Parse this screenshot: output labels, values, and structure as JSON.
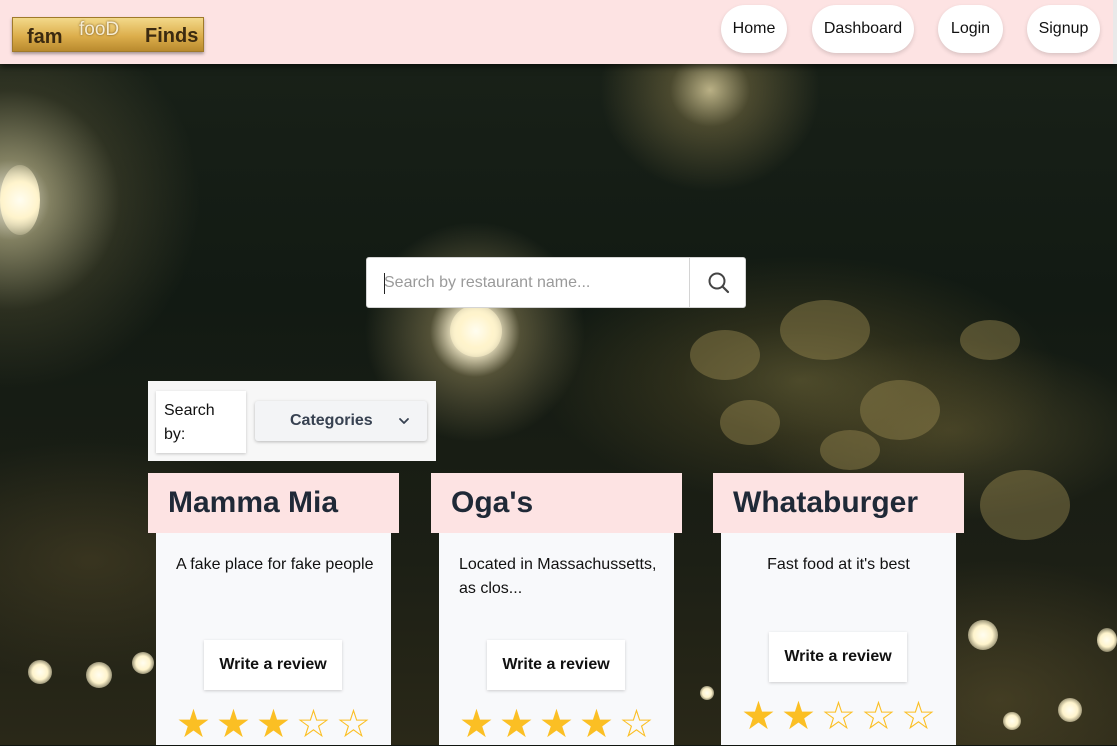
{
  "logo": {
    "word1": "fam",
    "word2": "fooD",
    "word3": "Finds"
  },
  "nav": {
    "home": "Home",
    "dashboard": "Dashboard",
    "login": "Login",
    "signup": "Signup"
  },
  "search": {
    "placeholder": "Search by restaurant name...",
    "value": ""
  },
  "filter": {
    "label": "Search by:",
    "categories_label": "Categories"
  },
  "restaurants": [
    {
      "name": "Mamma Mia",
      "description": "A fake place for fake people",
      "review_label": "Write a review",
      "rating": 3,
      "max_rating": 5
    },
    {
      "name": "Oga's",
      "description": "Located in Massachussetts, as clos...",
      "review_label": "Write a review",
      "rating": 4,
      "max_rating": 5
    },
    {
      "name": "Whataburger",
      "description": "Fast food at it's best",
      "review_label": "Write a review",
      "rating": 2,
      "max_rating": 5
    }
  ],
  "colors": {
    "navbar_bg": "#fde3e3",
    "card_title_bg": "#fde3e3",
    "star": "#fbbf24"
  }
}
